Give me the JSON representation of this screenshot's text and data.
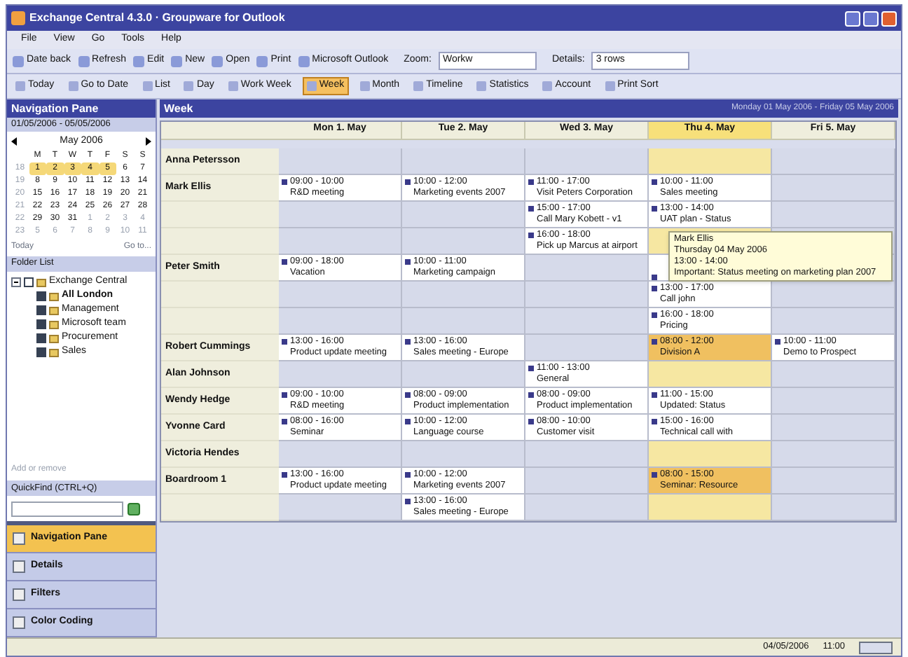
{
  "window": {
    "title": "Exchange Central 4.3.0 · Groupware for Outlook"
  },
  "menu": [
    "File",
    "View",
    "Go",
    "Tools",
    "Help"
  ],
  "toolbar1": [
    {
      "label": "Date back",
      "kind": "button"
    },
    {
      "label": "Refresh",
      "kind": "button"
    },
    {
      "label": "Edit",
      "kind": "button"
    },
    {
      "label": "New",
      "kind": "button"
    },
    {
      "label": "Open",
      "kind": "button"
    },
    {
      "label": "Print",
      "kind": "button"
    },
    {
      "label": "Microsoft Outlook",
      "kind": "button"
    },
    {
      "label": "Zoom:",
      "kind": "label"
    },
    {
      "label": "Workw",
      "kind": "field"
    },
    {
      "label": "Details:",
      "kind": "label"
    },
    {
      "label": "3 rows",
      "kind": "field"
    }
  ],
  "toolbar2": [
    {
      "label": "Today",
      "selected": false
    },
    {
      "label": "Go to Date",
      "selected": false
    },
    {
      "label": "List",
      "selected": false
    },
    {
      "label": "Day",
      "selected": false
    },
    {
      "label": "Work Week",
      "selected": false
    },
    {
      "label": "Week",
      "selected": true
    },
    {
      "label": "Month",
      "selected": false
    },
    {
      "label": "Timeline",
      "selected": false
    },
    {
      "label": "Statistics",
      "selected": false
    },
    {
      "label": "Account",
      "selected": false
    },
    {
      "label": "Print Sort",
      "selected": false
    }
  ],
  "navigation": {
    "title": "Navigation Pane",
    "range": "01/05/2006 - 05/05/2006",
    "month": "May 2006",
    "weekdays": [
      "M",
      "T",
      "W",
      "T",
      "F",
      "S",
      "S"
    ],
    "weeks": [
      {
        "number": "18",
        "days": [
          {
            "d": "1",
            "selected": true
          },
          {
            "d": "2",
            "selected": true
          },
          {
            "d": "3",
            "selected": true
          },
          {
            "d": "4",
            "selected": true
          },
          {
            "d": "5",
            "selected": true
          },
          {
            "d": "6",
            "selected": false
          },
          {
            "d": "7",
            "selected": false
          }
        ]
      },
      {
        "number": "19",
        "days": [
          {
            "d": "8",
            "selected": false
          },
          {
            "d": "9",
            "selected": false
          },
          {
            "d": "10",
            "selected": false
          },
          {
            "d": "11",
            "selected": false
          },
          {
            "d": "12",
            "selected": false
          },
          {
            "d": "13",
            "selected": false
          },
          {
            "d": "14",
            "selected": false
          }
        ]
      },
      {
        "number": "20",
        "days": [
          {
            "d": "15",
            "selected": false
          },
          {
            "d": "16",
            "selected": false
          },
          {
            "d": "17",
            "selected": false
          },
          {
            "d": "18",
            "selected": false
          },
          {
            "d": "19",
            "selected": false
          },
          {
            "d": "20",
            "selected": false
          },
          {
            "d": "21",
            "selected": false
          }
        ]
      },
      {
        "number": "21",
        "days": [
          {
            "d": "22",
            "selected": false
          },
          {
            "d": "23",
            "selected": false
          },
          {
            "d": "24",
            "selected": false
          },
          {
            "d": "25",
            "selected": false
          },
          {
            "d": "26",
            "selected": false
          },
          {
            "d": "27",
            "selected": false
          },
          {
            "d": "28",
            "selected": false
          }
        ]
      },
      {
        "number": "22",
        "days": [
          {
            "d": "29",
            "selected": false
          },
          {
            "d": "30",
            "selected": false
          },
          {
            "d": "31",
            "selected": false
          },
          {
            "d": "1",
            "selected": false
          },
          {
            "d": "2",
            "selected": false
          },
          {
            "d": "3",
            "selected": false
          },
          {
            "d": "4",
            "selected": false
          }
        ]
      },
      {
        "number": "23",
        "days": [
          {
            "d": "5",
            "selected": false
          },
          {
            "d": "6",
            "selected": false
          },
          {
            "d": "7",
            "selected": false
          },
          {
            "d": "8",
            "selected": false
          },
          {
            "d": "9",
            "selected": false
          },
          {
            "d": "10",
            "selected": false
          },
          {
            "d": "11",
            "selected": false
          }
        ]
      }
    ],
    "today": "Today",
    "goto": "Go to..."
  },
  "folder_list": {
    "title": "Folder List",
    "tree": [
      {
        "label": "Exchange Central",
        "expanded": true,
        "checked": false,
        "bold": false,
        "children": [
          {
            "label": "All London",
            "checked": true,
            "bold": true
          },
          {
            "label": "Management",
            "checked": true,
            "bold": false
          },
          {
            "label": "Microsoft team",
            "checked": true,
            "bold": false
          },
          {
            "label": "Procurement",
            "checked": true,
            "bold": false
          },
          {
            "label": "Sales",
            "checked": true,
            "bold": false
          }
        ]
      }
    ],
    "hint": "Add or remove"
  },
  "quickfind": {
    "title": "QuickFind (CTRL+Q)"
  },
  "nav_buttons": [
    {
      "label": "Navigation Pane",
      "selected": true
    },
    {
      "label": "Details",
      "selected": false
    },
    {
      "label": "Filters",
      "selected": false
    },
    {
      "label": "Color Coding",
      "selected": false
    }
  ],
  "calendar": {
    "title": "Week",
    "range": "Monday 01 May 2006 - Friday 05 May 2006",
    "columns": [
      {
        "label": "Mon 1. May",
        "today": false
      },
      {
        "label": "Tue 2. May",
        "today": false
      },
      {
        "label": "Wed 3. May",
        "today": false
      },
      {
        "label": "Thu 4. May",
        "today": true
      },
      {
        "label": "Fri 5. May",
        "today": false
      }
    ],
    "rows": [
      {
        "name": "Anna Petersson",
        "cells": [
          {
            "kind": "empty"
          },
          {
            "kind": "empty"
          },
          {
            "kind": "empty"
          },
          {
            "kind": "empty"
          },
          {
            "kind": "empty"
          }
        ]
      },
      {
        "name": "Mark Ellis",
        "cells": [
          {
            "kind": "event",
            "time": "09:00 - 10:00",
            "title": "R&D meeting",
            "highlight": false
          },
          {
            "kind": "event",
            "time": "10:00 - 12:00",
            "title": "Marketing events 2007",
            "highlight": false
          },
          {
            "kind": "event",
            "time": "11:00 - 17:00",
            "title": "Visit Peters Corporation",
            "highlight": false
          },
          {
            "kind": "event",
            "time": "10:00 - 11:00",
            "title": "Sales meeting",
            "highlight": false
          },
          {
            "kind": "empty"
          }
        ]
      },
      {
        "cells": [
          {
            "kind": "empty"
          },
          {
            "kind": "empty"
          },
          {
            "kind": "event",
            "time": "15:00 - 17:00",
            "title": "Call Mary Kobett - v1",
            "highlight": false
          },
          {
            "kind": "event",
            "time": "13:00 - 14:00",
            "title": "UAT plan - Status",
            "highlight": false
          },
          {
            "kind": "empty"
          }
        ]
      },
      {
        "cells": [
          {
            "kind": "empty"
          },
          {
            "kind": "empty"
          },
          {
            "kind": "event",
            "time": "16:00 - 18:00",
            "title": "Pick up Marcus at airport",
            "highlight": false
          },
          {
            "kind": "empty"
          },
          {
            "kind": "empty"
          }
        ]
      },
      {
        "name": "Peter Smith",
        "cells": [
          {
            "kind": "event",
            "time": "09:00 - 18:00",
            "title": "Vacation",
            "highlight": false
          },
          {
            "kind": "event",
            "time": "10:00 - 11:00",
            "title": "Marketing campaign",
            "highlight": false
          },
          {
            "kind": "empty"
          },
          {
            "kind": "covered"
          },
          {
            "kind": "empty"
          }
        ]
      },
      {
        "cells": [
          {
            "kind": "empty"
          },
          {
            "kind": "empty"
          },
          {
            "kind": "empty"
          },
          {
            "kind": "event",
            "time": "13:00 - 17:00",
            "title": "Call john",
            "highlight": false
          },
          {
            "kind": "empty"
          }
        ]
      },
      {
        "cells": [
          {
            "kind": "empty"
          },
          {
            "kind": "empty"
          },
          {
            "kind": "empty"
          },
          {
            "kind": "event",
            "time": "16:00 - 18:00",
            "title": "Pricing",
            "highlight": false
          },
          {
            "kind": "empty"
          }
        ]
      },
      {
        "name": "Robert Cummings",
        "cells": [
          {
            "kind": "event",
            "time": "13:00 - 16:00",
            "title": "Product update meeting",
            "highlight": false
          },
          {
            "kind": "event",
            "time": "13:00 - 16:00",
            "title": "Sales meeting - Europe",
            "highlight": false
          },
          {
            "kind": "empty"
          },
          {
            "kind": "event",
            "time": "08:00 - 12:00",
            "title": "Division A",
            "highlight": true
          },
          {
            "kind": "event",
            "time": "10:00 - 11:00",
            "title": "Demo to Prospect",
            "highlight": false
          }
        ]
      },
      {
        "name": "Alan Johnson",
        "cells": [
          {
            "kind": "empty"
          },
          {
            "kind": "empty"
          },
          {
            "kind": "event",
            "time": "11:00 - 13:00",
            "title": "General",
            "highlight": false
          },
          {
            "kind": "empty"
          },
          {
            "kind": "empty"
          }
        ]
      },
      {
        "name": "Wendy Hedge",
        "cells": [
          {
            "kind": "event",
            "time": "09:00 - 10:00",
            "title": "R&D meeting",
            "highlight": false
          },
          {
            "kind": "event",
            "time": "08:00 - 09:00",
            "title": "Product implementation",
            "highlight": false
          },
          {
            "kind": "event",
            "time": "08:00 - 09:00",
            "title": "Product implementation",
            "highlight": false
          },
          {
            "kind": "event",
            "time": "11:00 - 15:00",
            "title": "Updated: Status",
            "highlight": false
          },
          {
            "kind": "empty"
          }
        ]
      },
      {
        "name": "Yvonne Card",
        "cells": [
          {
            "kind": "event",
            "time": "08:00 - 16:00",
            "title": "Seminar",
            "highlight": false
          },
          {
            "kind": "event",
            "time": "10:00 - 12:00",
            "title": "Language course",
            "highlight": false
          },
          {
            "kind": "event",
            "time": "08:00 - 10:00",
            "title": "Customer visit",
            "highlight": false
          },
          {
            "kind": "event",
            "time": "15:00 - 16:00",
            "title": "Technical call with",
            "highlight": false
          },
          {
            "kind": "empty"
          }
        ]
      },
      {
        "name": "Victoria Hendes",
        "cells": [
          {
            "kind": "empty"
          },
          {
            "kind": "empty"
          },
          {
            "kind": "empty"
          },
          {
            "kind": "empty"
          },
          {
            "kind": "empty"
          }
        ]
      },
      {
        "name": "Boardroom 1",
        "cells": [
          {
            "kind": "event",
            "time": "13:00 - 16:00",
            "title": "Product update meeting",
            "highlight": false
          },
          {
            "kind": "event",
            "time": "10:00 - 12:00",
            "title": "Marketing events 2007",
            "highlight": false
          },
          {
            "kind": "empty"
          },
          {
            "kind": "event",
            "time": "08:00 - 15:00",
            "title": "Seminar: Resource",
            "highlight": true
          },
          {
            "kind": "empty"
          }
        ]
      },
      {
        "cells": [
          {
            "kind": "empty"
          },
          {
            "kind": "event",
            "time": "13:00 - 16:00",
            "title": "Sales meeting - Europe",
            "highlight": false
          },
          {
            "kind": "empty"
          },
          {
            "kind": "empty"
          },
          {
            "kind": "empty"
          }
        ]
      }
    ],
    "tooltip": {
      "name": "Mark Ellis",
      "date": "Thursday 04 May 2006",
      "time": "13:00 - 14:00",
      "text": "Important: Status meeting on marketing plan 2007"
    }
  },
  "status_bar": {
    "date": "04/05/2006",
    "time": "11:00"
  }
}
